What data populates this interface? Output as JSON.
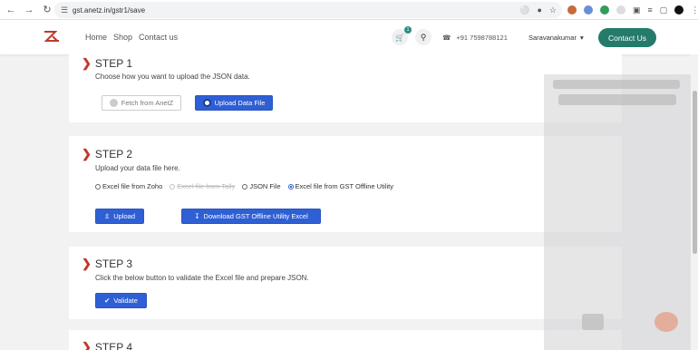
{
  "browser": {
    "url": "gst.anetz.in/gstr1/save",
    "back_icon": "arrow-left-icon",
    "forward_icon": "arrow-right-icon",
    "reload_icon": "reload-icon"
  },
  "header": {
    "nav": [
      "Home",
      "Shop",
      "Contact us"
    ],
    "cart_count": "1",
    "phone": "+91 7598788121",
    "user": "Saravanakumar",
    "contact_button": "Contact Us",
    "brand_color": "#247b6a"
  },
  "step1": {
    "title": "STEP 1",
    "desc": "Choose how you want to upload the JSON data.",
    "fetch_label": "Fetch from AnetZ",
    "upload_label": "Upload Data File"
  },
  "step2": {
    "title": "STEP 2",
    "desc": "Upload your data file here.",
    "options": [
      "Excel file from Zoho",
      "Excel file from Tally",
      "JSON File",
      "Excel file from GST Offline Utility"
    ],
    "selected": "Excel file from GST Offline Utility",
    "upload_label": "Upload",
    "download_label": "Download GST Offline Utility Excel"
  },
  "step3": {
    "title": "STEP 3",
    "desc": "Click the below button to validate the Excel file and prepare JSON.",
    "validate_label": "Validate"
  },
  "step4": {
    "title": "STEP 4"
  }
}
